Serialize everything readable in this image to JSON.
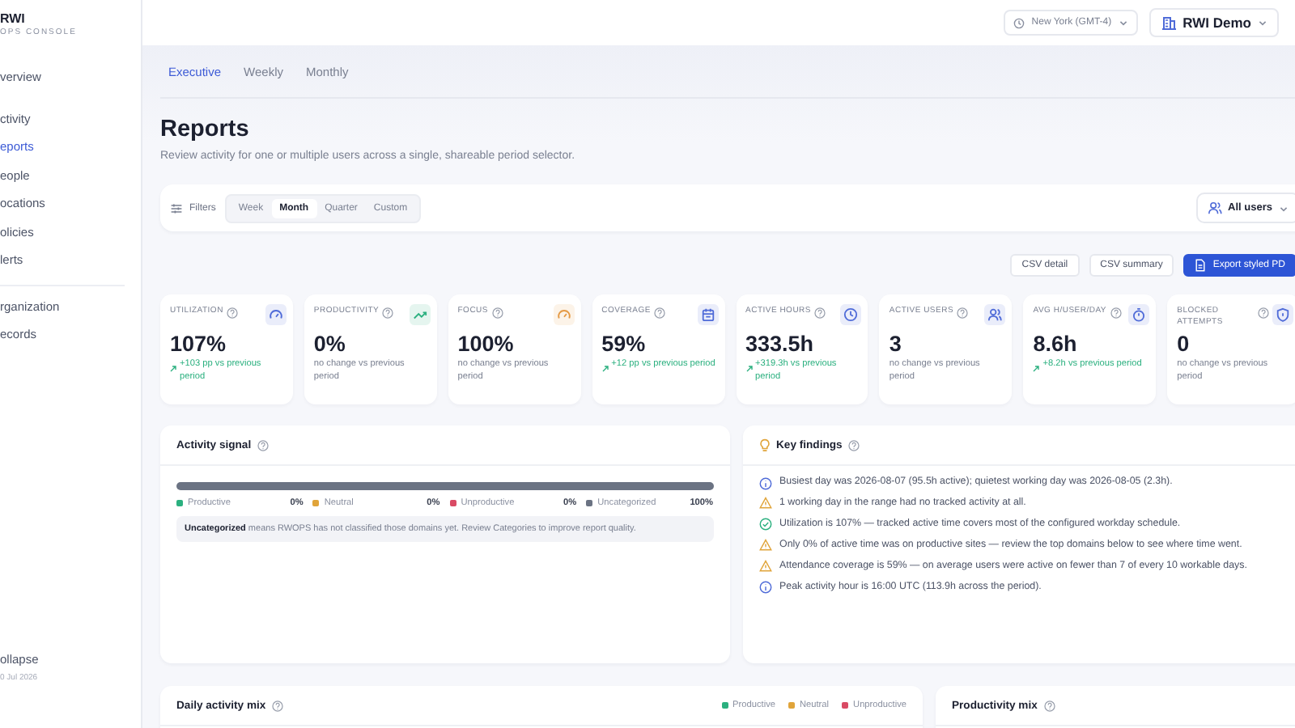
{
  "brand": {
    "name": "RWI",
    "subtitle": "OPS CONSOLE"
  },
  "sidebar": {
    "groups": [
      [
        {
          "label": "verview",
          "selected": false
        }
      ],
      [
        {
          "label": "ctivity",
          "selected": false
        },
        {
          "label": "eports",
          "selected": true
        },
        {
          "label": "eople",
          "selected": false
        },
        {
          "label": "ocations",
          "selected": false
        },
        {
          "label": "olicies",
          "selected": false
        },
        {
          "label": "lerts",
          "selected": false
        }
      ],
      [
        {
          "label": "rganization",
          "selected": false
        },
        {
          "label": "ecords",
          "selected": false
        }
      ]
    ],
    "collapse": "ollapse",
    "date": "0 Jul 2026"
  },
  "topbar": {
    "timezone": "New York (GMT-4)",
    "workspace": "RWI Demo"
  },
  "tabs": [
    {
      "label": "Executive",
      "selected": true
    },
    {
      "label": "Weekly",
      "selected": false
    },
    {
      "label": "Monthly",
      "selected": false
    }
  ],
  "title": "Reports",
  "subtitle": "Review activity for one or multiple users across a single, shareable period selector.",
  "filters": {
    "label": "Filters",
    "periods": [
      {
        "label": "Week",
        "selected": false
      },
      {
        "label": "Month",
        "selected": true
      },
      {
        "label": "Quarter",
        "selected": false
      },
      {
        "label": "Custom",
        "selected": false
      }
    ],
    "users": "All users"
  },
  "exports": [
    {
      "label": "CSV detail",
      "kind": "plain"
    },
    {
      "label": "CSV summary",
      "kind": "plain"
    },
    {
      "label": "Export styled PD",
      "kind": "primary"
    }
  ],
  "kpis": [
    {
      "label": "UTILIZATION",
      "value": "107%",
      "delta": "+103 pp vs previous period",
      "positive": true,
      "kind": "gauge",
      "color": "#4f6bd8"
    },
    {
      "label": "PRODUCTIVITY",
      "value": "0%",
      "delta": "no change vs previous period",
      "positive": false,
      "kind": "trend",
      "color": "#2bb07f"
    },
    {
      "label": "FOCUS",
      "value": "100%",
      "delta": "no change vs previous period",
      "positive": false,
      "kind": "gauge",
      "color": "#e59a45"
    },
    {
      "label": "COVERAGE",
      "value": "59%",
      "delta": "+12 pp vs previous period",
      "positive": true,
      "kind": "calendar",
      "color": "#4f6bd8"
    },
    {
      "label": "ACTIVE HOURS",
      "value": "333.5h",
      "delta": "+319.3h vs previous period",
      "positive": true,
      "kind": "clock",
      "color": "#4f6bd8"
    },
    {
      "label": "ACTIVE USERS",
      "value": "3",
      "delta": "no change vs previous period",
      "positive": false,
      "kind": "users",
      "color": "#4f6bd8"
    },
    {
      "label": "AVG H/USER/DAY",
      "value": "8.6h",
      "delta": "+8.2h vs previous period",
      "positive": true,
      "kind": "timer",
      "color": "#4f6bd8"
    },
    {
      "label": "BLOCKED ATTEMPTS",
      "value": "0",
      "delta": "no change vs previous period",
      "positive": false,
      "kind": "shield",
      "color": "#4f6bd8"
    }
  ],
  "activity_signal": {
    "title": "Activity signal",
    "segments": [
      {
        "label": "Productive",
        "value": "0%",
        "level": 0,
        "color": "#2bb07f"
      },
      {
        "label": "Neutral",
        "value": "0%",
        "level": 0,
        "color": "#e0a43a"
      },
      {
        "label": "Unproductive",
        "value": "0%",
        "level": 0,
        "color": "#d94a64"
      },
      {
        "label": "Uncategorized",
        "value": "100%",
        "level": 1,
        "color": "#6b7383"
      }
    ],
    "note": "**Uncategorized** means RWOPS has not classified those domains yet. Review Categories to improve report quality."
  },
  "key_findings": {
    "title": "Key findings",
    "items": [
      {
        "kind": "info",
        "text": "Busiest day was 2026-08-07 (95.5h active); quietest working day was 2026-08-05 (2.3h)."
      },
      {
        "kind": "warning",
        "text": "1 working day in the range had no tracked activity at all."
      },
      {
        "kind": "success",
        "text": "Utilization is 107% — tracked active time covers most of the configured workday schedule."
      },
      {
        "kind": "warning",
        "text": "Only 0% of active time was on productive sites — review the top domains below to see where time went."
      },
      {
        "kind": "warning",
        "text": "Attendance coverage is 59% — on average users were active on fewer than 7 of every 10 workable days."
      },
      {
        "kind": "info",
        "text": "Peak activity hour is 16:00 UTC (113.9h across the period)."
      }
    ]
  },
  "daily_mix": {
    "title": "Daily activity mix",
    "legend": [
      {
        "label": "Productive",
        "color": "#2bb07f"
      },
      {
        "label": "Neutral",
        "color": "#e0a43a"
      },
      {
        "label": "Unproductive",
        "color": "#d94a64"
      }
    ]
  },
  "productivity_mix": {
    "title": "Productivity mix"
  }
}
